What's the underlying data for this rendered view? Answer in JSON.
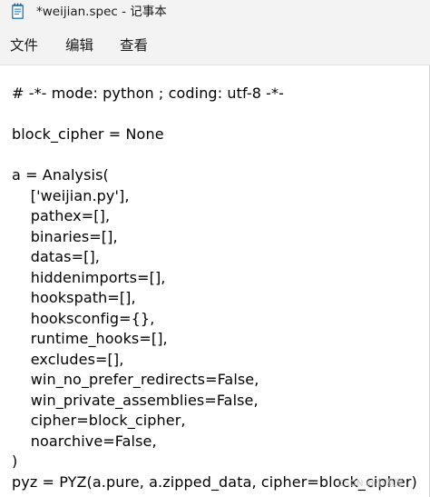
{
  "window": {
    "title": "*weijian.spec - 记事本",
    "app_icon": "notepad-icon"
  },
  "menu": {
    "file": "文件",
    "edit": "编辑",
    "view": "查看"
  },
  "editor": {
    "lines": [
      "# -*- mode: python ; coding: utf-8 -*-",
      "",
      "block_cipher = None",
      "",
      "a = Analysis(",
      "    ['weijian.py'],",
      "    pathex=[],",
      "    binaries=[],",
      "    datas=[],",
      "    hiddenimports=[],",
      "    hookspath=[],",
      "    hooksconfig={},",
      "    runtime_hooks=[],",
      "    excludes=[],",
      "    win_no_prefer_redirects=False,",
      "    win_private_assemblies=False,",
      "    cipher=block_cipher,",
      "    noarchive=False,",
      ")",
      "pyz = PYZ(a.pure, a.zipped_data, cipher=block_cipher)"
    ]
  },
  "watermark": "CSDN @小周周"
}
